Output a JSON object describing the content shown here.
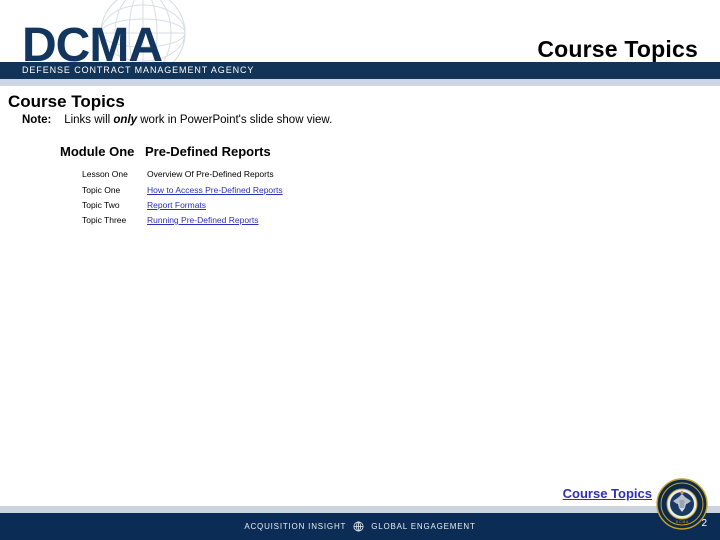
{
  "header": {
    "logo_text": "DCMA",
    "logo_icon": "globe-wireframe-icon",
    "agency_bar_text": "DEFENSE CONTRACT MANAGEMENT AGENCY",
    "title": "Course Topics"
  },
  "content": {
    "slide_title": "Course Topics",
    "note": {
      "label": "Note:",
      "text_before": "Links will ",
      "emphasis": "only",
      "text_after": " work in PowerPoint's slide show view."
    },
    "module": {
      "label": "Module One",
      "value": "Pre-Defined Reports"
    },
    "lesson": {
      "label": "Lesson One",
      "value": "Overview Of Pre-Defined Reports"
    },
    "topics": [
      {
        "label": "Topic One",
        "link": "How to Access Pre-Defined Reports"
      },
      {
        "label": "Topic Two",
        "link": "Report Formats"
      },
      {
        "label": "Topic Three",
        "link": "Running Pre-Defined Reports"
      }
    ]
  },
  "footer": {
    "link": "Course Topics",
    "tagline_left": "ACQUISITION INSIGHT",
    "tagline_icon": "globe-icon",
    "tagline_right": "GLOBAL ENGAGEMENT",
    "seal_icon": "dcma-seal-icon",
    "page_number": "2"
  },
  "colors": {
    "navy": "#123458",
    "footer_navy": "#0a2c55",
    "link_blue": "#2b30b5",
    "strip_gray": "#ccd4e0",
    "logo_navy": "#12365e"
  }
}
